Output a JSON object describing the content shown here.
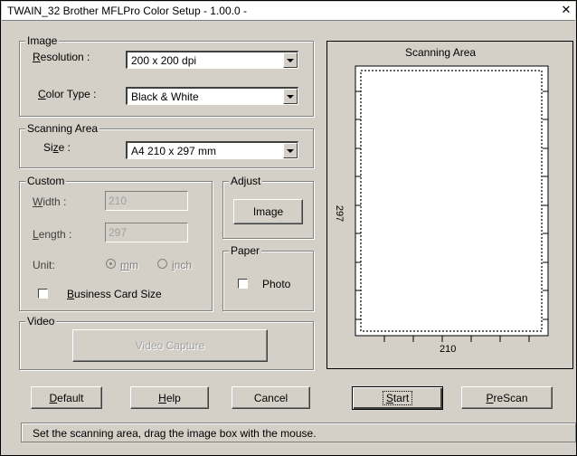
{
  "window": {
    "title": "TWAIN_32 Brother MFLPro Color Setup - 1.00.0 -",
    "close_glyph": "✕"
  },
  "image_group": {
    "legend": "Image",
    "resolution_label": "Resolution :",
    "resolution_value": "200 x 200 dpi",
    "color_type_label": "Color Type :",
    "color_type_value": "Black & White"
  },
  "scanning_area_group": {
    "legend": "Scanning Area",
    "size_label": "Size :",
    "size_value": "A4 210 x 297 mm"
  },
  "custom_group": {
    "legend": "Custom",
    "width_label": "Width :",
    "width_value": "210",
    "length_label": "Length :",
    "length_value": "297",
    "unit_label": "Unit:",
    "unit_mm": "mm",
    "unit_inch": "inch",
    "unit_selected": "mm",
    "business_card_label": "Business Card Size",
    "business_card_checked": false
  },
  "adjust_group": {
    "legend": "Adjust",
    "image_button": "Image"
  },
  "paper_group": {
    "legend": "Paper",
    "photo_label": "Photo",
    "photo_checked": false
  },
  "video_group": {
    "legend": "Video",
    "video_capture_button": "Video Capture"
  },
  "preview": {
    "title": "Scanning Area",
    "width_label": "210",
    "height_label": "297"
  },
  "buttons": {
    "default": "Default",
    "help": "Help",
    "cancel": "Cancel",
    "start": "Start",
    "prescan": "PreScan"
  },
  "status_text": "Set the scanning area, drag the image box with the mouse.",
  "colors": {
    "face": "#d4d0c8",
    "shadow": "#808080",
    "highlight": "#ffffff"
  }
}
